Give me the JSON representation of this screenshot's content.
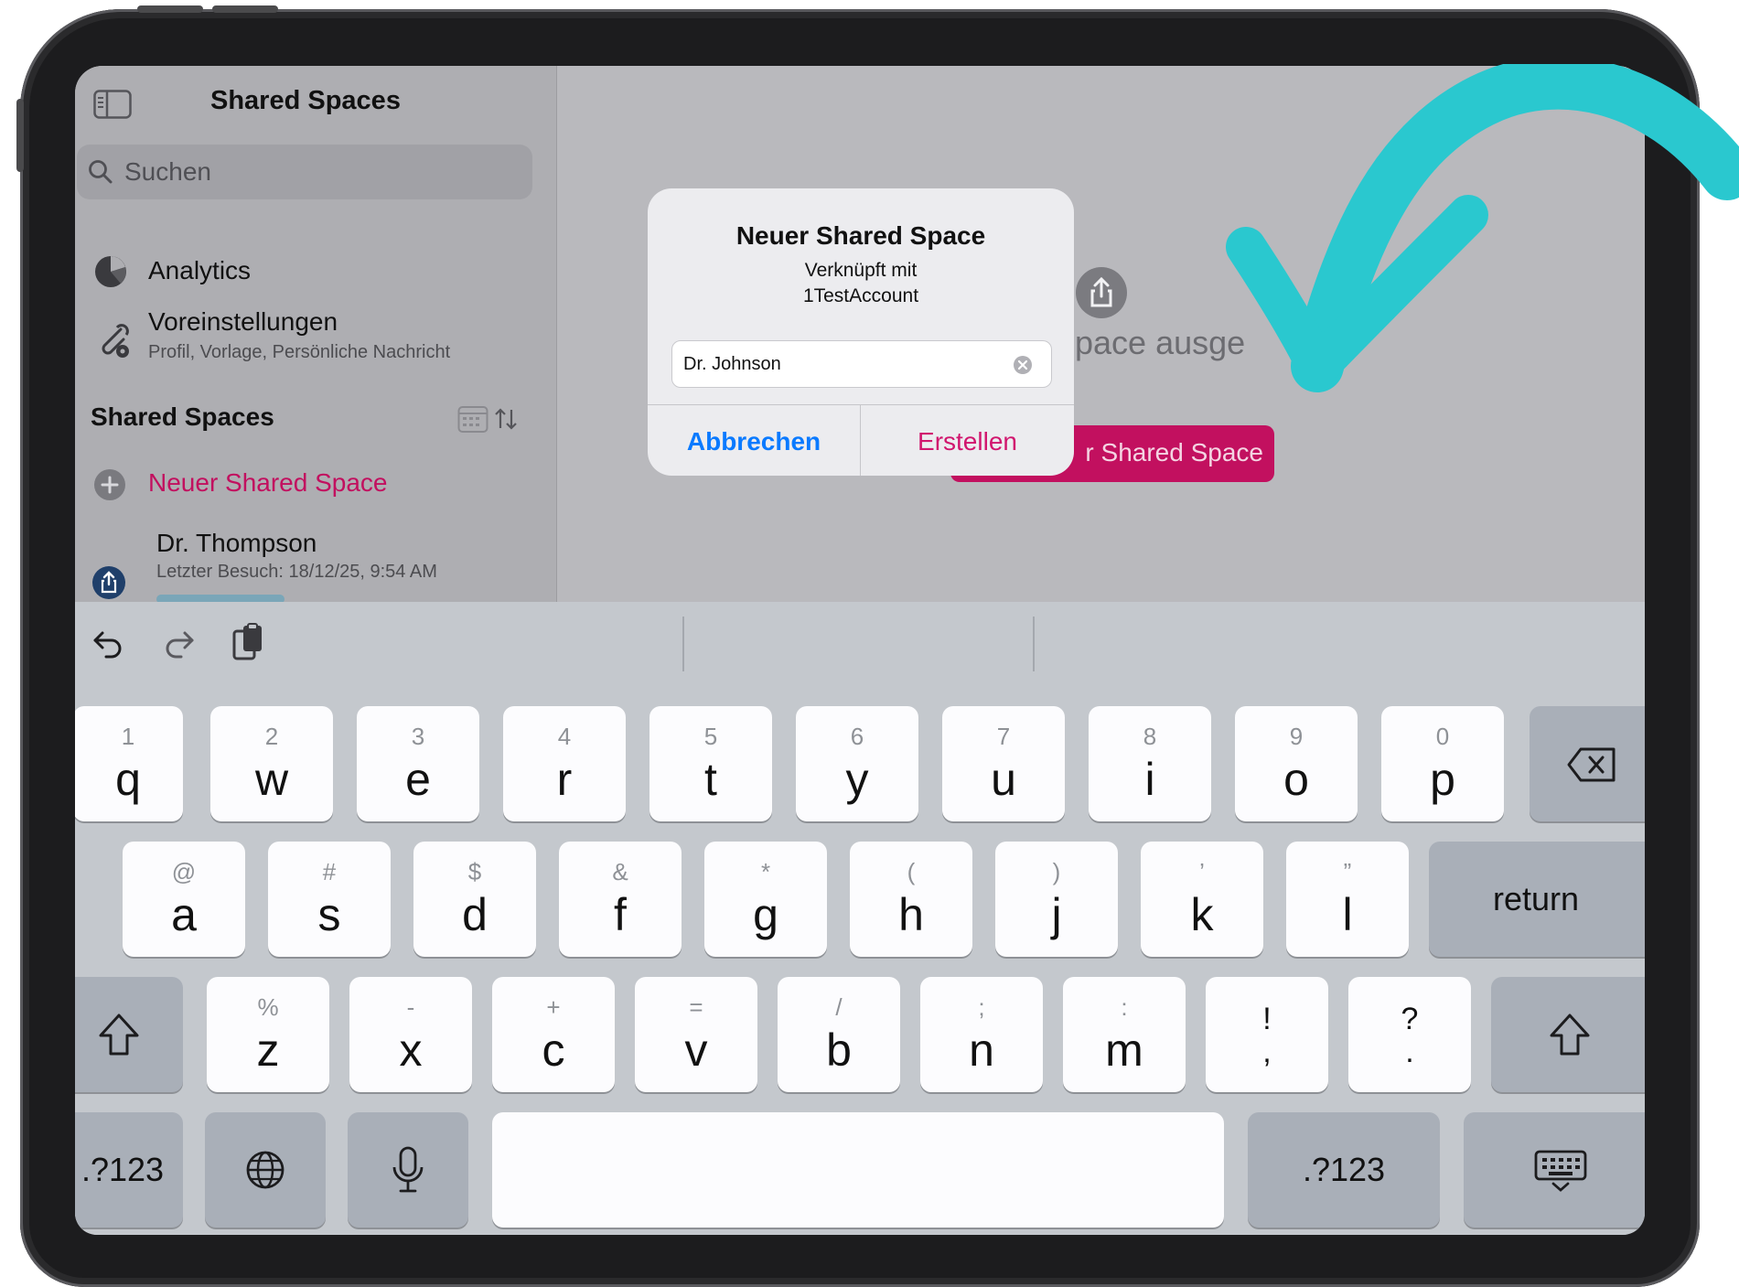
{
  "sidebar": {
    "title": "Shared Spaces",
    "search_placeholder": "Suchen",
    "analytics_label": "Analytics",
    "settings_label": "Voreinstellungen",
    "settings_sub": "Profil, Vorlage, Persönliche Nachricht",
    "section_title": "Shared Spaces",
    "new_space_label": "Neuer Shared Space",
    "space_item": {
      "name": "Dr. Thompson",
      "subtitle": "Letzter Besuch: 18/12/25, 9:54 AM"
    }
  },
  "detail": {
    "empty_text_visible": "Space ausge",
    "button_visible_label": "r Shared Space"
  },
  "dialog": {
    "title": "Neuer Shared Space",
    "message_line1": "Verknüpft mit",
    "message_line2": "1TestAccount",
    "input_value": "Dr. Johnson",
    "cancel_label": "Abbrechen",
    "create_label": "Erstellen"
  },
  "keyboard": {
    "row1": [
      {
        "sec": "1",
        "pri": "q"
      },
      {
        "sec": "2",
        "pri": "w"
      },
      {
        "sec": "3",
        "pri": "e"
      },
      {
        "sec": "4",
        "pri": "r"
      },
      {
        "sec": "5",
        "pri": "t"
      },
      {
        "sec": "6",
        "pri": "y"
      },
      {
        "sec": "7",
        "pri": "u"
      },
      {
        "sec": "8",
        "pri": "i"
      },
      {
        "sec": "9",
        "pri": "o"
      },
      {
        "sec": "0",
        "pri": "p"
      }
    ],
    "row2": [
      {
        "sec": "@",
        "pri": "a"
      },
      {
        "sec": "#",
        "pri": "s"
      },
      {
        "sec": "$",
        "pri": "d"
      },
      {
        "sec": "&",
        "pri": "f"
      },
      {
        "sec": "*",
        "pri": "g"
      },
      {
        "sec": "(",
        "pri": "h"
      },
      {
        "sec": ")",
        "pri": "j"
      },
      {
        "sec": "’",
        "pri": "k"
      },
      {
        "sec": "”",
        "pri": "l"
      }
    ],
    "row3": [
      {
        "sec": "%",
        "pri": "z"
      },
      {
        "sec": "-",
        "pri": "x"
      },
      {
        "sec": "+",
        "pri": "c"
      },
      {
        "sec": "=",
        "pri": "v"
      },
      {
        "sec": "/",
        "pri": "b"
      },
      {
        "sec": ";",
        "pri": "n"
      },
      {
        "sec": ":",
        "pri": "m"
      },
      {
        "sec": "!",
        "pri": ","
      },
      {
        "sec": "?",
        "pri": "."
      }
    ],
    "return_label": "return",
    "numbers_label": ".?123"
  },
  "colors": {
    "accent_pink": "#d1166e",
    "ios_blue": "#0a7aff",
    "annotation_arrow": "#2ac8cf"
  },
  "icons": [
    "sidebar-toggle-icon",
    "search-icon",
    "pie-chart-icon",
    "paperclip-gear-icon",
    "calendar-icon",
    "sort-icon",
    "plus-circle-icon",
    "share-icon",
    "clear-icon",
    "undo-icon",
    "redo-icon",
    "clipboard-icon",
    "delete-icon",
    "shift-icon",
    "globe-icon",
    "microphone-icon",
    "keyboard-hide-icon"
  ]
}
